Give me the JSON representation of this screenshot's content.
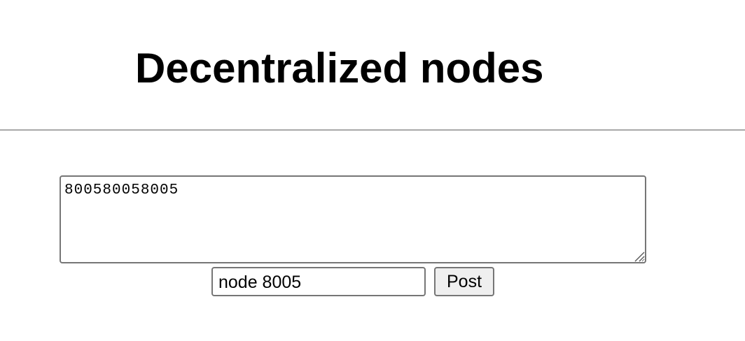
{
  "header": {
    "title": "Decentralized nodes"
  },
  "composer": {
    "message_value": "800580058005",
    "node_value": "node 8005",
    "post_label": "Post"
  },
  "colors": {
    "divider": "#a8a8a8",
    "field_border": "#767676",
    "button_background": "#efefef"
  },
  "icons": {
    "textarea_grip": "resize-grip-icon"
  }
}
